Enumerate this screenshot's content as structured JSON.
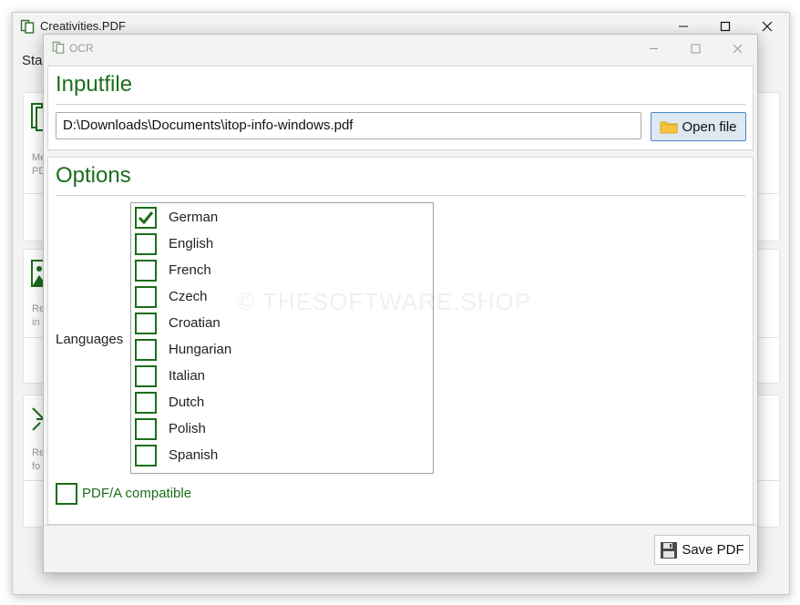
{
  "main_window": {
    "title": "Creativities.PDF",
    "menu_fragment": "Star",
    "card_texts": [
      "Me",
      "PD",
      "Re",
      "in",
      "Re",
      "fo"
    ]
  },
  "ocr_dialog": {
    "title": "OCR",
    "input_section": {
      "header": "Inputfile",
      "file_path": "D:\\Downloads\\Documents\\itop-info-windows.pdf",
      "open_button_label": "Open file"
    },
    "options_section": {
      "header": "Options",
      "languages_label": "Languages",
      "languages": [
        {
          "label": "German",
          "checked": true
        },
        {
          "label": "English",
          "checked": false
        },
        {
          "label": "French",
          "checked": false
        },
        {
          "label": "Czech",
          "checked": false
        },
        {
          "label": "Croatian",
          "checked": false
        },
        {
          "label": "Hungarian",
          "checked": false
        },
        {
          "label": "Italian",
          "checked": false
        },
        {
          "label": "Dutch",
          "checked": false
        },
        {
          "label": "Polish",
          "checked": false
        },
        {
          "label": "Spanish",
          "checked": false
        }
      ],
      "pdfa_label": "PDF/A compatible",
      "pdfa_checked": false
    },
    "save_button_label": "Save PDF",
    "watermark": "© THESOFTWARE.SHOP"
  },
  "colors": {
    "accent_green": "#1b6e1b",
    "button_blue_border": "#4a86c7",
    "button_blue_fill": "#dde8f3"
  }
}
